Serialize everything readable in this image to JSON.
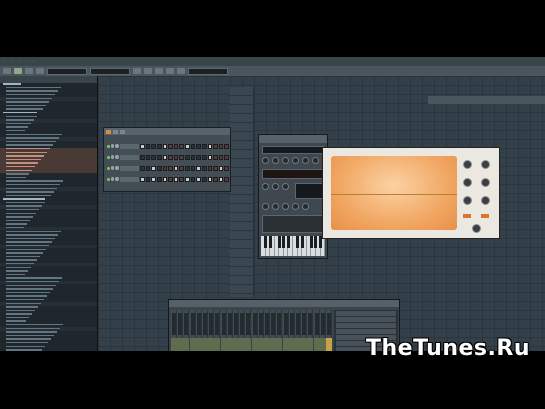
{
  "watermark": "TheTunes.Ru",
  "channels": [
    {
      "steps": [
        1,
        0,
        0,
        0,
        1,
        0,
        0,
        0,
        1,
        0,
        0,
        0,
        1,
        0,
        0,
        0
      ]
    },
    {
      "steps": [
        0,
        0,
        0,
        0,
        1,
        0,
        0,
        0,
        0,
        0,
        0,
        0,
        1,
        0,
        0,
        0
      ]
    },
    {
      "steps": [
        0,
        0,
        1,
        0,
        0,
        0,
        1,
        0,
        0,
        0,
        1,
        0,
        0,
        0,
        1,
        0
      ]
    },
    {
      "steps": [
        1,
        0,
        1,
        0,
        1,
        0,
        1,
        0,
        1,
        0,
        1,
        0,
        1,
        0,
        1,
        0
      ]
    }
  ],
  "colors": {
    "accent": "#d98a43",
    "sampler_screen": "#f1a864"
  },
  "icons": [
    "play-icon",
    "stop-icon",
    "record-icon",
    "folder-icon",
    "close-icon"
  ]
}
